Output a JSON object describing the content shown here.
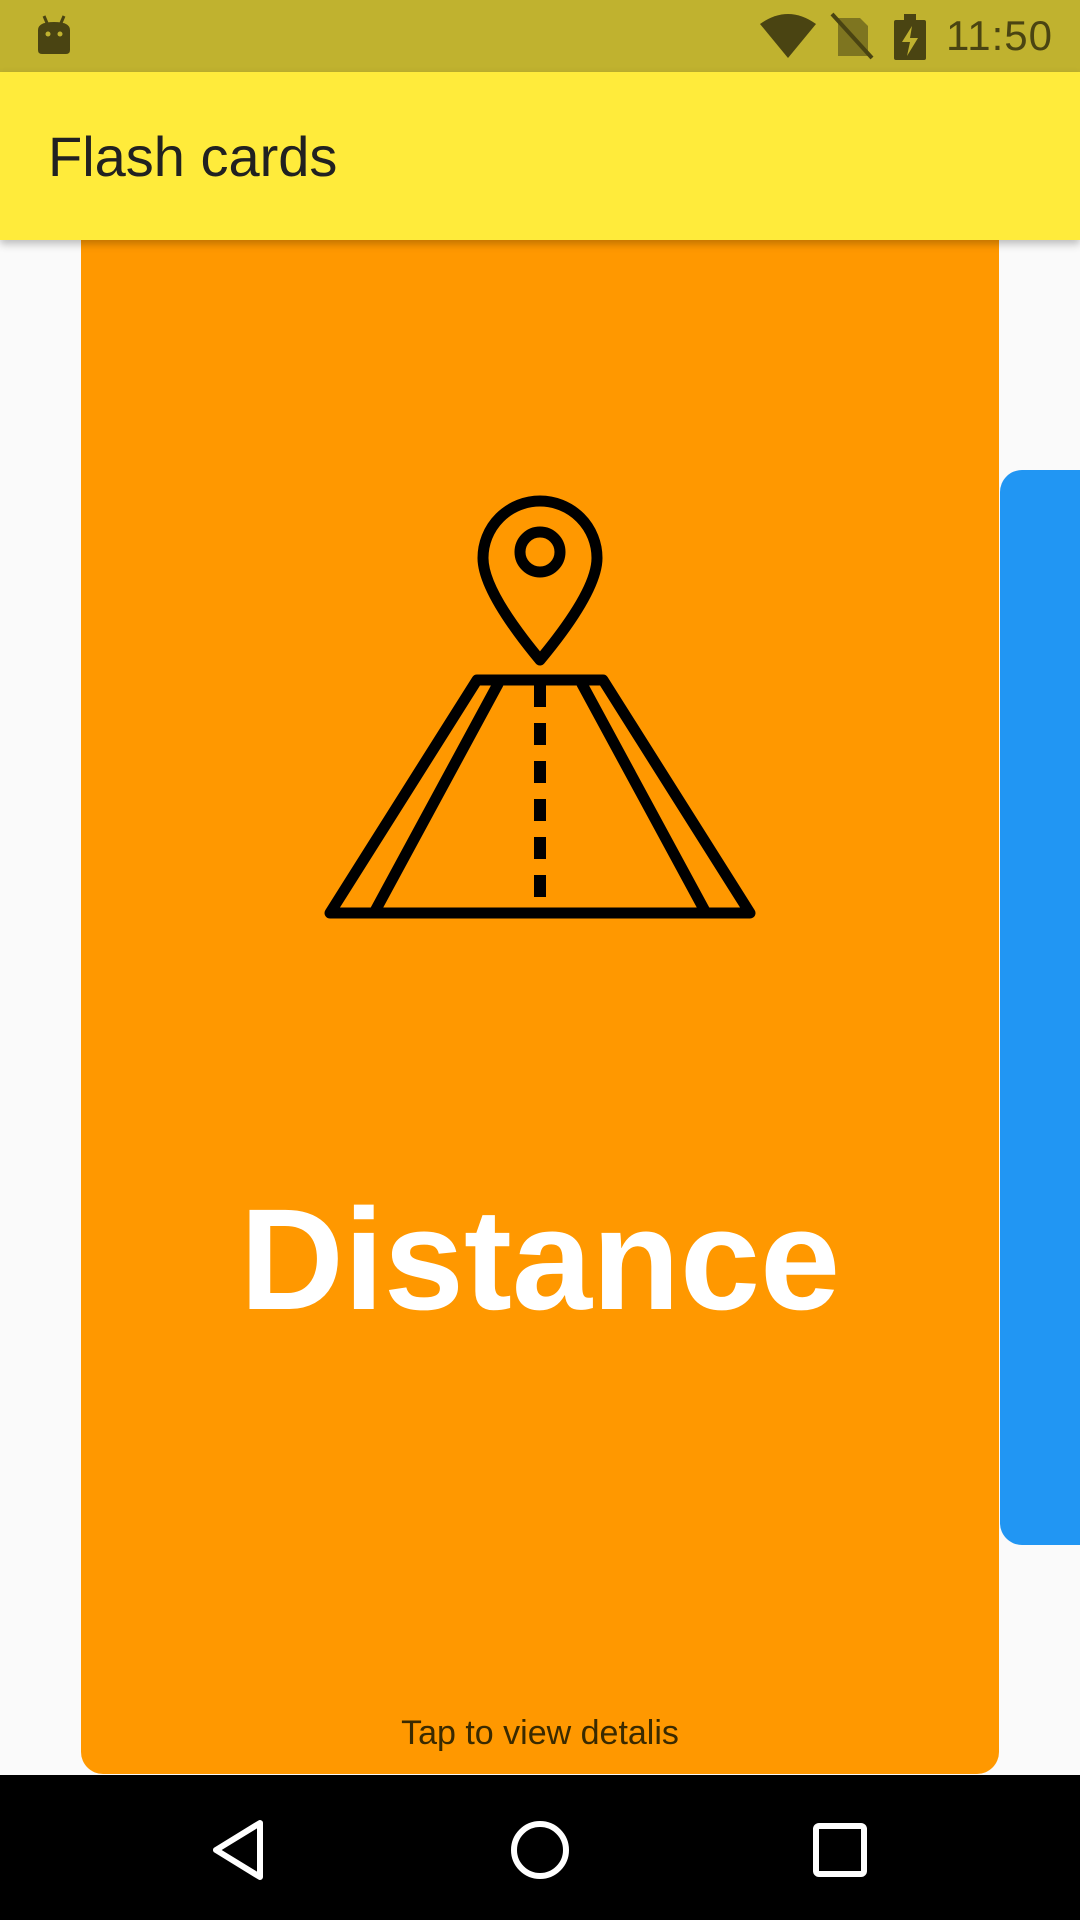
{
  "status_bar": {
    "time": "11:50",
    "icons": [
      "android-icon",
      "wifi-icon",
      "no-sim-icon",
      "battery-charging-icon"
    ]
  },
  "app_bar": {
    "title": "Flash cards"
  },
  "card": {
    "word": "Distance",
    "hint": "Tap to view detalis",
    "icon": "road-with-location-pin-icon",
    "color": "#ff9800"
  },
  "next_card": {
    "color": "#2196f3"
  },
  "nav_bar": {
    "icons": [
      "back-icon",
      "home-icon",
      "recent-apps-icon"
    ]
  },
  "colors": {
    "status_bar": "#c0b22f",
    "app_bar": "#ffeb3b",
    "background": "#fafafa"
  }
}
